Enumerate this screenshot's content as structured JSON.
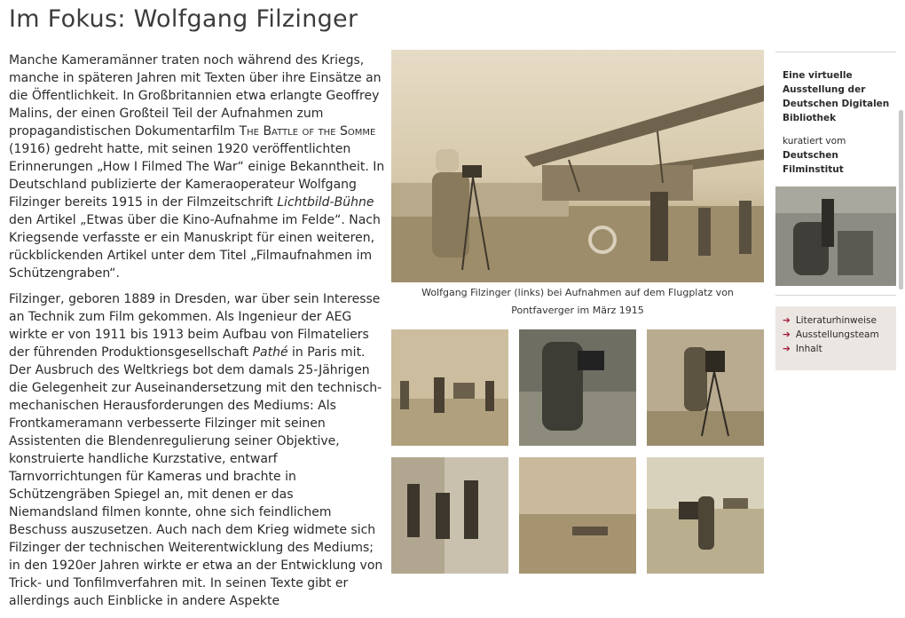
{
  "page": {
    "title": "Im Fokus: Wolfgang Filzinger"
  },
  "article": {
    "p1": {
      "a": "Manche Kameramänner traten noch während des Kriegs, manche in späteren Jahren mit Texten über ihre Einsätze an die Öffentlichkeit. In Großbritannien etwa erlangte Geoffrey Malins, der einen Großteil Teil der Aufnahmen zum propagandistischen Dokumentarfilm ",
      "film": "The Battle of the Somme",
      "b": " (1916) gedreht hatte, mit seinen 1920 veröffentlichten Erinnerungen „How I Filmed The War“ einige Bekanntheit. In Deutschland publizierte der Kameraoperateur Wolfgang Filzinger bereits 1915 in der Filmzeitschrift ",
      "magazine": "Lichtbild-Bühne",
      "c": " den Artikel „Etwas über die Kino-Aufnahme im Felde“. Nach Kriegsende verfasste er ein Manuskript für einen weiteren, rückblickenden Artikel unter dem Titel „Filmaufnahmen im Schützengraben“."
    },
    "p2": {
      "a": "Filzinger, geboren 1889 in Dresden, war über sein Interesse an Technik zum Film gekommen. Als Ingenieur der AEG wirkte er von 1911 bis 1913 beim Aufbau von Filmateliers der führenden Produktionsgesellschaft ",
      "company": "Pathé",
      "b": " in Paris mit. Der Ausbruch des Weltkriegs bot dem damals 25-Jährigen die Gelegenheit zur Auseinandersetzung mit den technisch-mechanischen Herausforderungen des Mediums: Als Frontkameramann verbesserte Filzinger mit seinen Assistenten die Blendenregulierung seiner Objektive, konstruierte handliche Kurzstative, entwarf Tarnvorrichtungen für Kameras und brachte in Schützengräben Spiegel an, mit denen er das Niemandsland filmen konnte, ohne sich feindlichem Beschuss auszusetzen. Auch nach dem Krieg widmete sich Filzinger der technischen Weiterentwicklung des Mediums; in den 1920er Jahren wirkte er etwa an der Entwicklung von Trick- und Tonfilmverfahren mit. In seinen Texte gibt er allerdings auch Einblicke in andere Aspekte"
    }
  },
  "hero": {
    "caption": "Wolfgang Filzinger (links) bei Aufnahmen auf dem Flugplatz von Pontfaverger im März 1915"
  },
  "sidebar": {
    "exhibition": "Eine virtuelle Ausstellung der Deutschen Digitalen Bibliothek",
    "curated_label": "kuratiert vom",
    "curator": "Deutschen Filminstitut",
    "links": [
      "Literaturhinweise",
      "Ausstellungsteam",
      "Inhalt"
    ]
  },
  "colors": {
    "accent": "#a3163b",
    "sepia": "#b5a688",
    "panel": "#ebe6e2"
  }
}
